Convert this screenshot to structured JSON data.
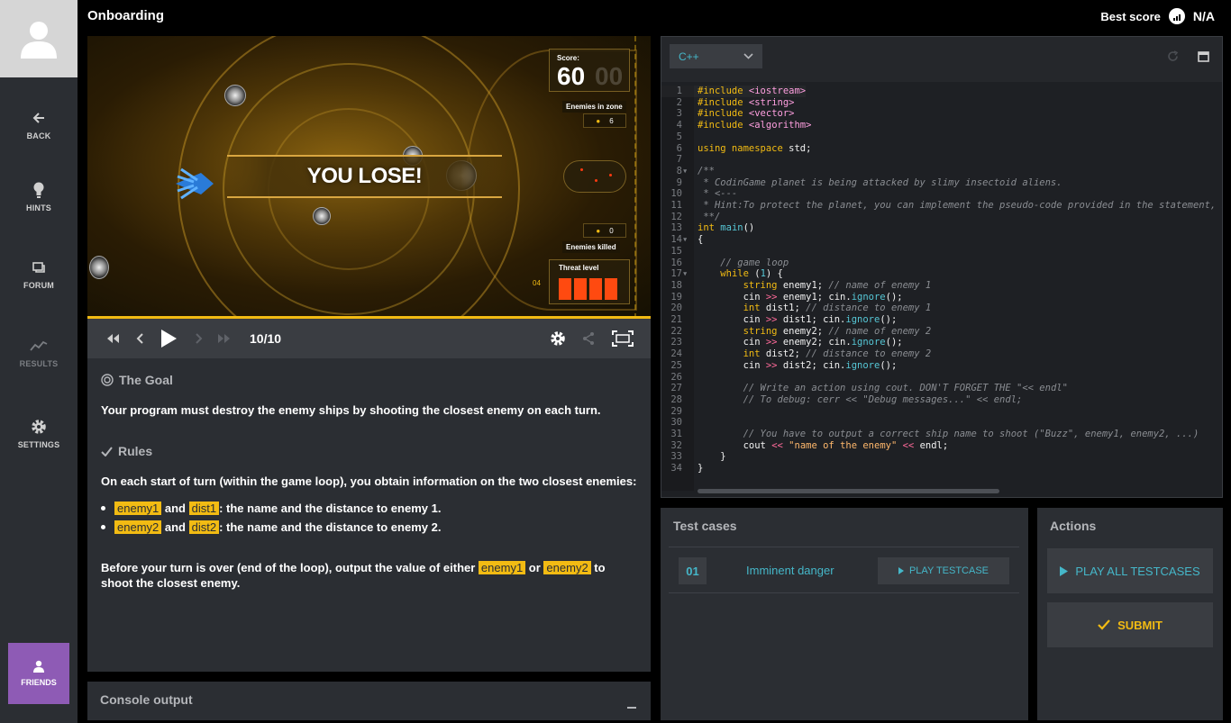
{
  "header": {
    "title": "Onboarding",
    "best_score_label": "Best score",
    "best_score_value": "N/A"
  },
  "sidebar": {
    "items": [
      {
        "label": "BACK",
        "icon": "arrow-left-icon"
      },
      {
        "label": "HINTS",
        "icon": "lightbulb-icon"
      },
      {
        "label": "FORUM",
        "icon": "forum-icon"
      },
      {
        "label": "RESULTS",
        "icon": "results-chart-icon"
      },
      {
        "label": "SETTINGS",
        "icon": "gear-icon"
      }
    ],
    "friends_label": "FRIENDS"
  },
  "viewer": {
    "banner": "YOU LOSE!",
    "score_label": "Score:",
    "score_value": "60",
    "score_ghost": "00",
    "enemies_in_zone_label": "Enemies in zone",
    "enemies_in_zone_value": "6",
    "enemies_killed_label": "Enemies killed",
    "enemies_killed_value": "0",
    "threat_label": "Threat level",
    "threat_value": "04",
    "progress": 1.0
  },
  "player": {
    "frame_counter": "10/10"
  },
  "statement": {
    "goal_title": "The Goal",
    "goal_text": "Your program must destroy the enemy ships by shooting the closest enemy on each turn.",
    "rules_title": "Rules",
    "rules_intro": "On each start of turn (within the game loop), you obtain information on the two closest enemies:",
    "rule1": {
      "var_a": "enemy1",
      "and": "and",
      "var_b": "dist1",
      "text": ": the name and the distance to enemy 1."
    },
    "rule2": {
      "var_a": "enemy2",
      "and": "and",
      "var_b": "dist2",
      "text": ": the name and the distance to enemy 2."
    },
    "final": {
      "before": "Before your turn is over (end of the loop), output the value of either",
      "var_a": "enemy1",
      "or": "or",
      "var_b": "enemy2",
      "after": "to shoot the closest enemy."
    }
  },
  "console": {
    "title": "Console output"
  },
  "editor": {
    "language": "C++",
    "lines": [
      {
        "n": "1",
        "html": "<span class='kw-pre'>#include</span> <span class='kw-inc'>&lt;iostream&gt;</span>"
      },
      {
        "n": "2",
        "html": "<span class='kw-pre'>#include</span> <span class='kw-inc'>&lt;string&gt;</span>"
      },
      {
        "n": "3",
        "html": "<span class='kw-pre'>#include</span> <span class='kw-inc'>&lt;vector&gt;</span>"
      },
      {
        "n": "4",
        "html": "<span class='kw-pre'>#include</span> <span class='kw-inc'>&lt;algorithm&gt;</span>"
      },
      {
        "n": "5",
        "html": ""
      },
      {
        "n": "6",
        "html": "<span class='kw-key'>using namespace</span> std;"
      },
      {
        "n": "7",
        "html": ""
      },
      {
        "n": "8",
        "fold": true,
        "html": "<span class='kw-com'>/**</span>"
      },
      {
        "n": "9",
        "html": "<span class='kw-com'> * CodinGame planet is being attacked by slimy insectoid aliens.</span>"
      },
      {
        "n": "10",
        "html": "<span class='kw-com'> * &lt;---</span>"
      },
      {
        "n": "11",
        "html": "<span class='kw-com'> * Hint:To protect the planet, you can implement the pseudo-code provided in the statement, below the player.</span>"
      },
      {
        "n": "12",
        "html": "<span class='kw-com'> **/</span>"
      },
      {
        "n": "13",
        "html": "<span class='kw-type'>int</span> <span class='kw-call'>main</span>()"
      },
      {
        "n": "14",
        "fold": true,
        "html": "{"
      },
      {
        "n": "15",
        "html": ""
      },
      {
        "n": "16",
        "html": "    <span class='kw-com'>// game loop</span>"
      },
      {
        "n": "17",
        "fold": true,
        "html": "    <span class='kw-key'>while</span> (<span class='kw-num'>1</span>) {"
      },
      {
        "n": "18",
        "html": "        <span class='kw-type'>string</span> enemy1; <span class='kw-com'>// name of enemy 1</span>"
      },
      {
        "n": "19",
        "html": "        cin <span class='kw-op'>&gt;&gt;</span> enemy1; cin.<span class='kw-call'>ignore</span>();"
      },
      {
        "n": "20",
        "html": "        <span class='kw-type'>int</span> dist1; <span class='kw-com'>// distance to enemy 1</span>"
      },
      {
        "n": "21",
        "html": "        cin <span class='kw-op'>&gt;&gt;</span> dist1; cin.<span class='kw-call'>ignore</span>();"
      },
      {
        "n": "22",
        "html": "        <span class='kw-type'>string</span> enemy2; <span class='kw-com'>// name of enemy 2</span>"
      },
      {
        "n": "23",
        "html": "        cin <span class='kw-op'>&gt;&gt;</span> enemy2; cin.<span class='kw-call'>ignore</span>();"
      },
      {
        "n": "24",
        "html": "        <span class='kw-type'>int</span> dist2; <span class='kw-com'>// distance to enemy 2</span>"
      },
      {
        "n": "25",
        "html": "        cin <span class='kw-op'>&gt;&gt;</span> dist2; cin.<span class='kw-call'>ignore</span>();"
      },
      {
        "n": "26",
        "html": ""
      },
      {
        "n": "27",
        "html": "        <span class='kw-com'>// Write an action using cout. DON'T FORGET THE \"&lt;&lt; endl\"</span>"
      },
      {
        "n": "28",
        "html": "        <span class='kw-com'>// To debug: cerr &lt;&lt; \"Debug messages...\" &lt;&lt; endl;</span>"
      },
      {
        "n": "29",
        "html": ""
      },
      {
        "n": "30",
        "html": ""
      },
      {
        "n": "31",
        "html": "        <span class='kw-com'>// You have to output a correct ship name to shoot (\"Buzz\", enemy1, enemy2, ...)</span>"
      },
      {
        "n": "32",
        "html": "        cout <span class='kw-op'>&lt;&lt;</span> <span class='kw-str'>\"name of the enemy\"</span> <span class='kw-op'>&lt;&lt;</span> endl;"
      },
      {
        "n": "33",
        "html": "    }"
      },
      {
        "n": "34",
        "html": "}"
      }
    ]
  },
  "testcases": {
    "title": "Test cases",
    "items": [
      {
        "num": "01",
        "name": "Imminent danger",
        "button": "PLAY TESTCASE"
      }
    ]
  },
  "actions": {
    "title": "Actions",
    "play_all": "PLAY ALL TESTCASES",
    "submit": "SUBMIT"
  },
  "colors": {
    "accent_yellow": "#f2bb13",
    "accent_cyan": "#45b7c9",
    "friends_purple": "#8e5bb5",
    "panel": "#2b2e33"
  }
}
